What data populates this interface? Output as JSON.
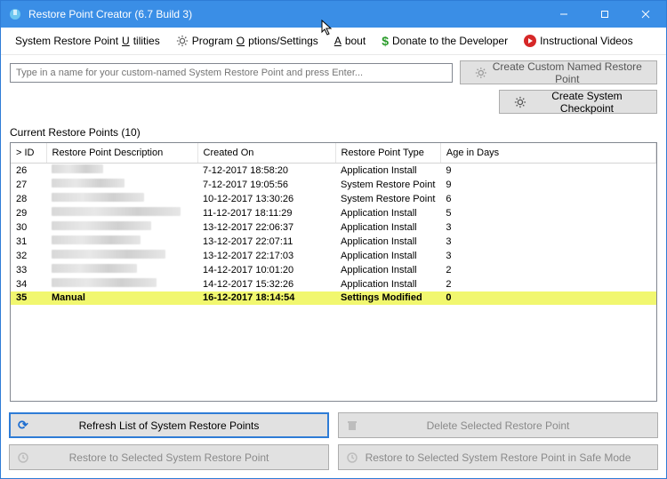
{
  "window": {
    "title": "Restore Point Creator (6.7 Build 3)"
  },
  "menu": {
    "utilities_pre": "System Restore Point ",
    "utilities_u": "U",
    "utilities_post": "tilities",
    "options_pre": "Program ",
    "options_u": "O",
    "options_post": "ptions/Settings",
    "about_u": "A",
    "about_post": "bout",
    "donate": "Donate to the Developer",
    "videos": "Instructional Videos"
  },
  "top": {
    "name_placeholder": "Type in a name for your custom-named System Restore Point and press Enter...",
    "create_custom": "Create Custom Named Restore Point",
    "create_checkpoint": "Create System Checkpoint"
  },
  "section_label": "Current Restore Points (10)",
  "columns": {
    "id": "> ID",
    "desc": "Restore Point Description",
    "created": "Created On",
    "type": "Restore Point Type",
    "age": "Age in Days"
  },
  "rows": [
    {
      "id": "26",
      "desc": "",
      "created": "7-12-2017 18:58:20",
      "type": "Application Install",
      "age": "9",
      "blur_w": 58
    },
    {
      "id": "27",
      "desc": "",
      "created": "7-12-2017 19:05:56",
      "type": "System Restore Point",
      "age": "9",
      "blur_w": 82
    },
    {
      "id": "28",
      "desc": "",
      "created": "10-12-2017 13:30:26",
      "type": "System Restore Point",
      "age": "6",
      "blur_w": 104
    },
    {
      "id": "29",
      "desc": "",
      "created": "11-12-2017 18:11:29",
      "type": "Application Install",
      "age": "5",
      "blur_w": 145
    },
    {
      "id": "30",
      "desc": "",
      "created": "13-12-2017 22:06:37",
      "type": "Application Install",
      "age": "3",
      "blur_w": 112
    },
    {
      "id": "31",
      "desc": "",
      "created": "13-12-2017 22:07:11",
      "type": "Application Install",
      "age": "3",
      "blur_w": 100
    },
    {
      "id": "32",
      "desc": "",
      "created": "13-12-2017 22:17:03",
      "type": "Application Install",
      "age": "3",
      "blur_w": 128
    },
    {
      "id": "33",
      "desc": "",
      "created": "14-12-2017 10:01:20",
      "type": "Application Install",
      "age": "2",
      "blur_w": 96
    },
    {
      "id": "34",
      "desc": "",
      "created": "14-12-2017 15:32:26",
      "type": "Application Install",
      "age": "2",
      "blur_w": 118
    },
    {
      "id": "35",
      "desc": "Manual",
      "created": "16-12-2017 18:14:54",
      "type": "Settings Modified",
      "age": "0",
      "highlight": true
    }
  ],
  "buttons": {
    "refresh": "Refresh List of System Restore Points",
    "delete": "Delete Selected Restore Point",
    "restore": "Restore to Selected System Restore Point",
    "restore_safe": "Restore to Selected System Restore Point in Safe Mode"
  }
}
